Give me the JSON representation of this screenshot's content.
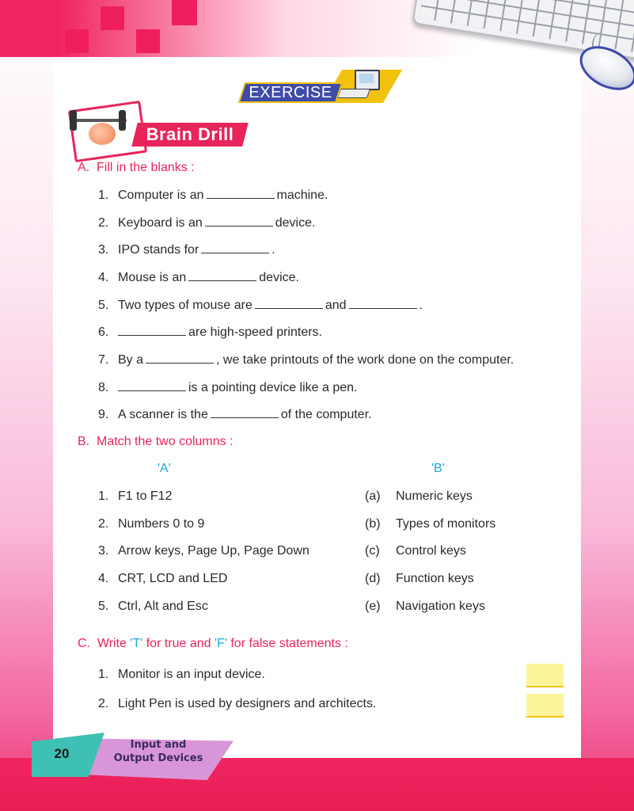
{
  "exercise_banner": "EXERCISE",
  "section_title": "Brain Drill",
  "sections": {
    "a": {
      "label": "A.",
      "title": "Fill in the blanks :",
      "items": [
        {
          "num": "1.",
          "before": "Computer is an",
          "after": "machine."
        },
        {
          "num": "2.",
          "before": "Keyboard is an",
          "after": "device."
        },
        {
          "num": "3.",
          "before": "IPO stands for",
          "after": "."
        },
        {
          "num": "4.",
          "before": "Mouse is an",
          "after": "device."
        },
        {
          "num": "5.",
          "before": "Two types of mouse are",
          "middle": "and",
          "after": "."
        },
        {
          "num": "6.",
          "before": "",
          "after": "are high-speed printers."
        },
        {
          "num": "7.",
          "before": "By a",
          "after": ", we take printouts of the work done on the computer."
        },
        {
          "num": "8.",
          "before": "",
          "after": "is a pointing device like a pen."
        },
        {
          "num": "9.",
          "before": "A scanner is the",
          "after": "of the computer."
        }
      ]
    },
    "b": {
      "label": "B.",
      "title": "Match the two columns :",
      "col_a": "'A'",
      "col_b": "'B'",
      "left": [
        {
          "num": "1.",
          "text": "F1 to F12"
        },
        {
          "num": "2.",
          "text": "Numbers 0 to 9"
        },
        {
          "num": "3.",
          "text": "Arrow keys, Page Up, Page Down"
        },
        {
          "num": "4.",
          "text": "CRT, LCD and LED"
        },
        {
          "num": "5.",
          "text": "Ctrl, Alt and Esc"
        }
      ],
      "right": [
        {
          "letter": "(a)",
          "text": "Numeric keys"
        },
        {
          "letter": "(b)",
          "text": "Types of monitors"
        },
        {
          "letter": "(c)",
          "text": "Control keys"
        },
        {
          "letter": "(d)",
          "text": "Function keys"
        },
        {
          "letter": "(e)",
          "text": "Navigation keys"
        }
      ]
    },
    "c": {
      "label": "C.",
      "title_pre": "Write",
      "t_mark": "'T'",
      "title_mid": "for true and",
      "f_mark": "'F'",
      "title_post": "for false statements :",
      "items": [
        {
          "num": "1.",
          "text": "Monitor is an input device."
        },
        {
          "num": "2.",
          "text": "Light Pen is used by designers and architects."
        }
      ]
    }
  },
  "footer": {
    "page_number": "20",
    "chapter_line1": "Input and",
    "chapter_line2": "Output Devices"
  },
  "colors": {
    "accent_pink": "#e8245a",
    "accent_blue": "#1aa7df",
    "banner_blue": "#3f4ba7",
    "yellow": "#f2c20f",
    "teal": "#3fc0b4",
    "lilac": "#d896d8"
  }
}
